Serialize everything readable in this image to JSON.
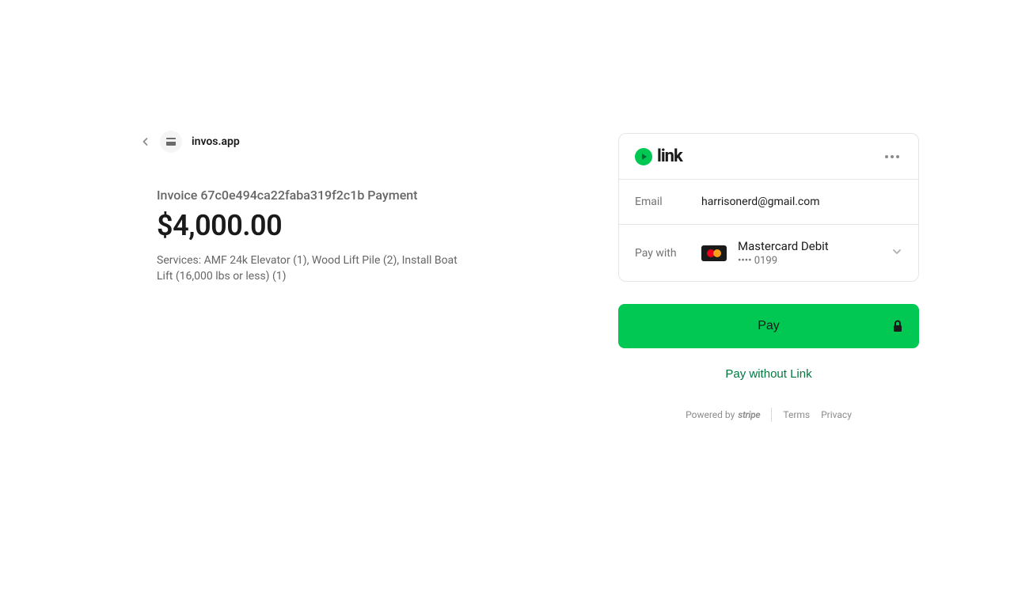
{
  "merchant": {
    "name": "invos.app"
  },
  "invoice": {
    "title": "Invoice 67c0e494ca22faba319f2c1b Payment",
    "amount": "$4,000.00",
    "description": "Services: AMF 24k Elevator (1), Wood Lift Pile (2), Install Boat Lift (16,000 lbs or less) (1)"
  },
  "link": {
    "brand": "link",
    "email_label": "Email",
    "email_value": "harrisonerd@gmail.com",
    "paywith_label": "Pay with",
    "card_type": "Mastercard Debit",
    "card_last4": "•••• 0199"
  },
  "buttons": {
    "pay": "Pay",
    "pay_without": "Pay without Link"
  },
  "footer": {
    "powered": "Powered by",
    "stripe": "stripe",
    "terms": "Terms",
    "privacy": "Privacy"
  }
}
